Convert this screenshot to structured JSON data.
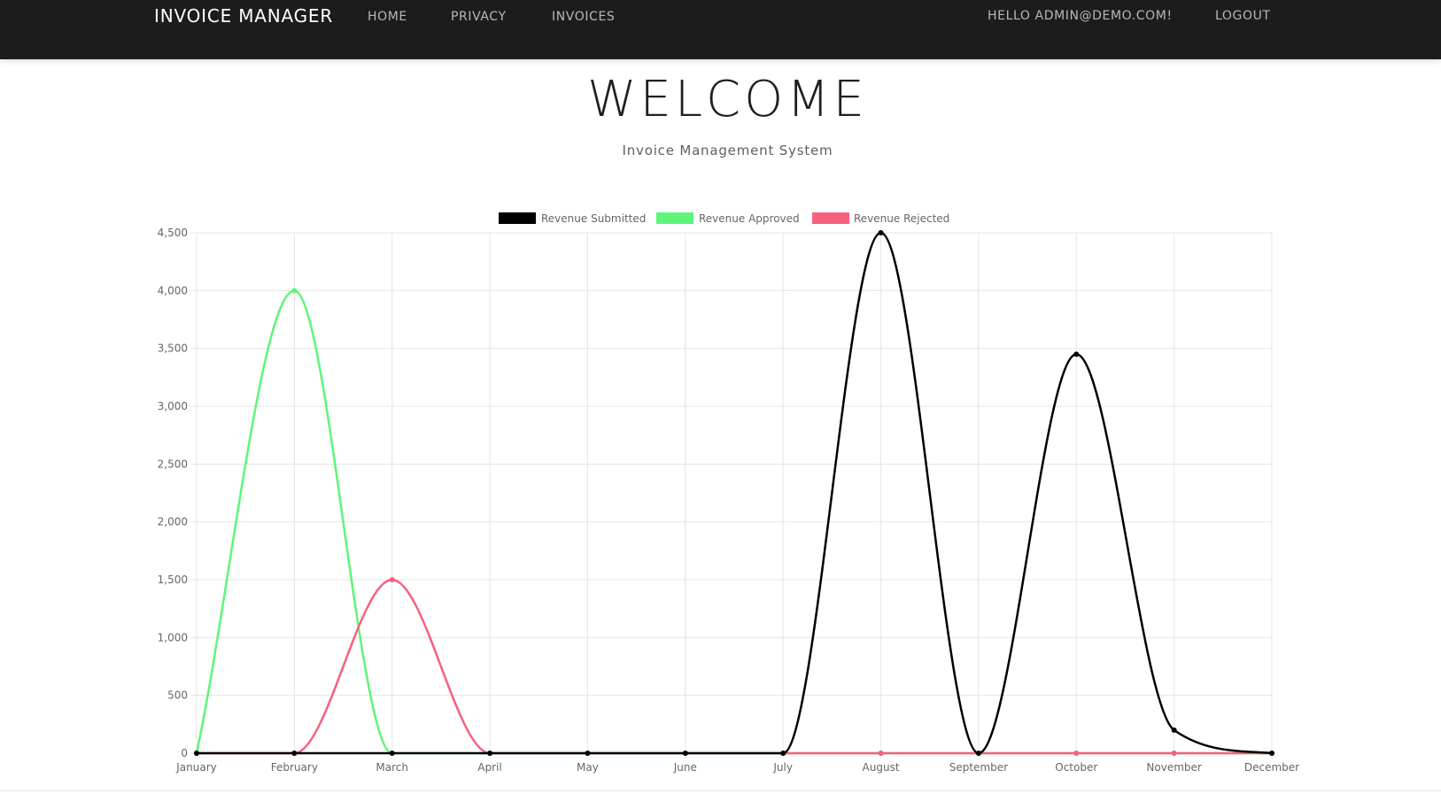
{
  "navbar": {
    "brand": "INVOICE MANAGER",
    "links": [
      "HOME",
      "PRIVACY",
      "INVOICES"
    ],
    "greeting": "HELLO ADMIN@DEMO.COM!",
    "logout": "LOGOUT"
  },
  "hero": {
    "title": "WELCOME",
    "subtitle": "Invoice Management System"
  },
  "chart_data": {
    "type": "line",
    "categories": [
      "January",
      "February",
      "March",
      "April",
      "May",
      "June",
      "July",
      "August",
      "September",
      "October",
      "November",
      "December"
    ],
    "series": [
      {
        "name": "Revenue Submitted",
        "color": "#000000",
        "values": [
          0,
          0,
          0,
          0,
          0,
          0,
          0,
          4500,
          0,
          3450,
          200,
          0
        ]
      },
      {
        "name": "Revenue Approved",
        "color": "#5ef57a",
        "values": [
          0,
          4000,
          0,
          0,
          0,
          0,
          0,
          0,
          0,
          0,
          0,
          0
        ]
      },
      {
        "name": "Revenue Rejected",
        "color": "#f7607f",
        "values": [
          0,
          0,
          1500,
          0,
          0,
          0,
          0,
          0,
          0,
          0,
          0,
          0
        ]
      }
    ],
    "y_ticks": [
      "0",
      "500",
      "1,000",
      "1,500",
      "2,000",
      "2,500",
      "3,000",
      "3,500",
      "4,000",
      "4,500"
    ],
    "ylim": [
      0,
      4500
    ],
    "grid": true,
    "legend": "top"
  }
}
